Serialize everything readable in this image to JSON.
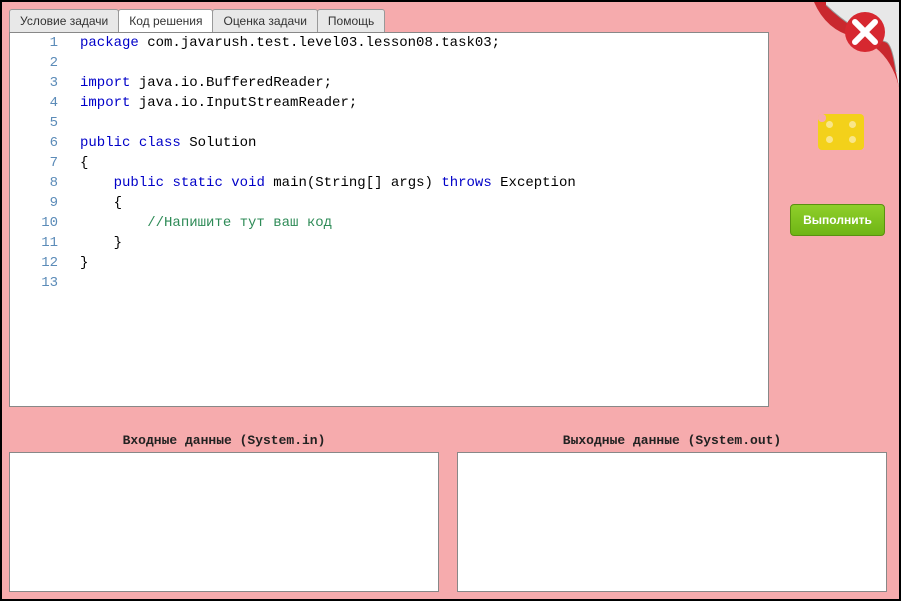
{
  "tabs": {
    "task_condition": "Условие задачи",
    "solution_code": "Код решения",
    "task_grade": "Оценка задачи",
    "help": "Помощь"
  },
  "active_tab": "Код решения",
  "code": {
    "lines": [
      {
        "n": "1",
        "tokens": [
          {
            "t": "package",
            "c": "kw"
          },
          {
            "t": " com.javarush.test.level03.lesson08.task03;",
            "c": "pkg"
          }
        ]
      },
      {
        "n": "2",
        "tokens": []
      },
      {
        "n": "3",
        "tokens": [
          {
            "t": "import",
            "c": "kw"
          },
          {
            "t": " java.io.BufferedReader;",
            "c": "pkg"
          }
        ]
      },
      {
        "n": "4",
        "tokens": [
          {
            "t": "import",
            "c": "kw"
          },
          {
            "t": " java.io.InputStreamReader;",
            "c": "pkg"
          }
        ]
      },
      {
        "n": "5",
        "tokens": []
      },
      {
        "n": "6",
        "tokens": [
          {
            "t": "public",
            "c": "kw"
          },
          {
            "t": " ",
            "c": ""
          },
          {
            "t": "class",
            "c": "kw"
          },
          {
            "t": " Solution",
            "c": "cls"
          }
        ]
      },
      {
        "n": "7",
        "tokens": [
          {
            "t": "{",
            "c": "cls"
          }
        ]
      },
      {
        "n": "8",
        "tokens": [
          {
            "t": "    ",
            "c": ""
          },
          {
            "t": "public",
            "c": "kw"
          },
          {
            "t": " ",
            "c": ""
          },
          {
            "t": "static",
            "c": "kw"
          },
          {
            "t": " ",
            "c": ""
          },
          {
            "t": "void",
            "c": "kw"
          },
          {
            "t": " main(String[] args) ",
            "c": "cls"
          },
          {
            "t": "throws",
            "c": "kw"
          },
          {
            "t": " Exception",
            "c": "cls"
          }
        ]
      },
      {
        "n": "9",
        "tokens": [
          {
            "t": "    {",
            "c": "cls"
          }
        ]
      },
      {
        "n": "10",
        "tokens": [
          {
            "t": "        ",
            "c": ""
          },
          {
            "t": "//Напишите тут ваш код",
            "c": "cmt"
          }
        ]
      },
      {
        "n": "11",
        "tokens": [
          {
            "t": "    }",
            "c": "cls"
          }
        ]
      },
      {
        "n": "12",
        "tokens": [
          {
            "t": "}",
            "c": "cls"
          }
        ]
      },
      {
        "n": "13",
        "tokens": []
      }
    ]
  },
  "io": {
    "input_label": "Входные данные (System.in)",
    "output_label": "Выходные данные (System.out)",
    "input_value": "",
    "output_value": ""
  },
  "buttons": {
    "run": "Выполнить"
  }
}
